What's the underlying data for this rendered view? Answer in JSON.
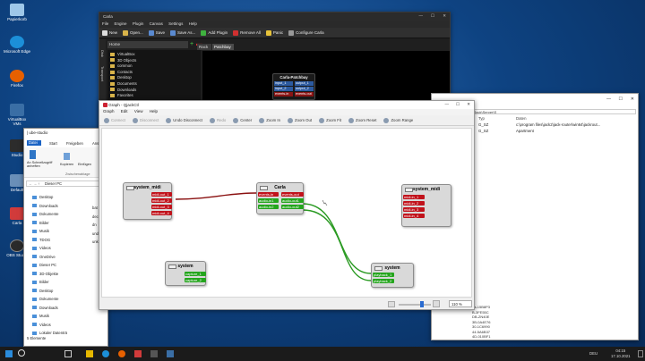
{
  "desktop": {
    "icons": [
      {
        "label": "Papierkorb",
        "color": "#9ec7e8"
      },
      {
        "label": "Microsoft Edge",
        "color": "#1c8fd8"
      },
      {
        "label": "Firefox",
        "color": "#e66000"
      },
      {
        "label": "VirtualBox VMs",
        "color": "#3a6ea5"
      },
      {
        "label": "Studio",
        "color": "#2c2c2c"
      },
      {
        "label": "Default",
        "color": "#6a8fb8"
      },
      {
        "label": "Carla",
        "color": "#d13b3b"
      },
      {
        "label": "OBS Studio",
        "color": "#2a2a2a"
      }
    ]
  },
  "carla": {
    "title": "Carla",
    "menu": [
      "File",
      "Engine",
      "Plugin",
      "Canvas",
      "Settings",
      "Help"
    ],
    "toolbar": [
      "New",
      "Open...",
      "Save",
      "Save As...",
      "Add Plugin",
      "Remove All",
      "Panic",
      "Configure Carla"
    ],
    "side_tabs": [
      "Disk",
      "Transport"
    ],
    "home": "Home",
    "tabs": [
      "Rack",
      "Patchbay"
    ],
    "tree": [
      "VirtualBox",
      "3D Objects",
      "common",
      "Contacts",
      "Desktop",
      "Documents",
      "Downloads",
      "Favorites"
    ],
    "patchbay": {
      "title": "Carla-Patchbay",
      "ports": [
        "input_1",
        "output_1",
        "input_2",
        "output_2",
        "events-in",
        "events-out"
      ]
    }
  },
  "explorer": {
    "title": "| ube-studio",
    "tabs": [
      "Datei",
      "Start",
      "Freigeben",
      "Ansicht"
    ],
    "ribbon": [
      "An Schnellzugriff anheften",
      "Kopieren",
      "Einfügen",
      "Zwischenablage"
    ],
    "path": "Dieser PC",
    "items": [
      "Desktop",
      "Downloads",
      "Dokumente",
      "Bilder",
      "Musik",
      "TDOG",
      "Videos",
      "OneDrive",
      "Dieser PC",
      "3D-Objekte",
      "Bilder",
      "Desktop",
      "Dokumente",
      "Downloads",
      "Musik",
      "Videos",
      "Lokaler Datenträ"
    ],
    "status": "5 Elemente",
    "files": [
      "bat",
      "dec",
      "dn",
      "und",
      "unk"
    ]
  },
  "registry": {
    "path": "...tool\\..\\...\\SOFTWARE\\Jack\\Server\\S",
    "cols": [
      "Typ",
      "Daten"
    ],
    "rows": [
      {
        "type": "G_SZ",
        "data": "c:\\program files\\jack2\\jack-router\\win64\\jackrout..."
      },
      {
        "type": "G_SZ",
        "data": "Apartment"
      }
    ],
    "keys": [
      "ba-15B8P3",
      "B-3FE55C",
      "DB-ZN40E",
      "3B-0A4E76",
      "30-1C6990",
      "44-5A6B37",
      "4D-010BF1"
    ]
  },
  "qjackctl": {
    "title": "Graph - QjackCtl",
    "menu": [
      "Graph",
      "Edit",
      "View",
      "Help"
    ],
    "toolbar": [
      "Connect",
      "Disconnect",
      "Undo Disconnect",
      "Redo",
      "Center",
      "Zoom In",
      "Zoom Out",
      "Zoom Fit",
      "Zoom Reset",
      "Zoom Range"
    ],
    "zoom": "110 %",
    "nodes": {
      "sys_midi_l": {
        "title": "system_midi",
        "ports": [
          "midi-out_1",
          "midi-out_2",
          "midi-out_3",
          "midi-out_4"
        ]
      },
      "carla": {
        "title": "Carla",
        "ports_in": [
          "events-in",
          "audio-in1",
          "audio-in2"
        ],
        "ports_out": [
          "events-out",
          "audio-out1",
          "audio-out2"
        ]
      },
      "sys_midi_r": {
        "title": "system_midi",
        "ports": [
          "midi-in_1",
          "midi-in_2",
          "midi-in_3",
          "midi-in_4"
        ]
      },
      "sys_cap": {
        "title": "system",
        "ports": [
          "capture_1",
          "capture_2"
        ]
      },
      "sys_play": {
        "title": "system",
        "ports": [
          "playback_1",
          "playback_2"
        ]
      }
    }
  },
  "taskbar": {
    "time": "04:15",
    "date": "17.10.2021",
    "lang": "DEU"
  }
}
